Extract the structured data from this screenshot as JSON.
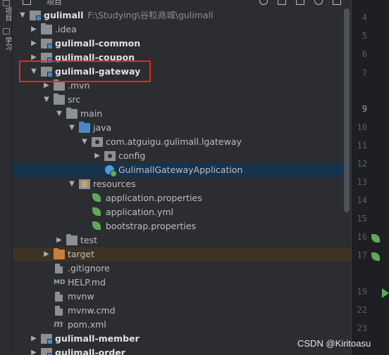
{
  "toolbar": {
    "panel_title": "项目"
  },
  "side_strip": {
    "project_tab": "项目",
    "learn_tab": "学习"
  },
  "editor": {
    "tab_partial": "app"
  },
  "tree": {
    "root": {
      "name": "gulimall",
      "path": "F:\\Studying\\谷粒商城\\gulimall"
    },
    "rows": [
      {
        "label": ".idea",
        "depth": 1,
        "arrow": "right",
        "icon": "folder",
        "bold": false
      },
      {
        "label": "gulimall-common",
        "depth": 1,
        "arrow": "right",
        "icon": "modfolder",
        "bold": true
      },
      {
        "label": "gulimall-coupon",
        "depth": 1,
        "arrow": "right",
        "icon": "modfolder",
        "bold": true
      },
      {
        "label": "gulimall-gateway",
        "depth": 1,
        "arrow": "down",
        "icon": "modfolder",
        "bold": true
      },
      {
        "label": ".mvn",
        "depth": 2,
        "arrow": "right",
        "icon": "folder",
        "bold": false
      },
      {
        "label": "src",
        "depth": 2,
        "arrow": "down",
        "icon": "folder",
        "bold": false
      },
      {
        "label": "main",
        "depth": 3,
        "arrow": "down",
        "icon": "folder",
        "bold": false
      },
      {
        "label": "java",
        "depth": 4,
        "arrow": "down",
        "icon": "folder-blue",
        "bold": false
      },
      {
        "label": "com.atguigu.gulimall.lgateway",
        "depth": 5,
        "arrow": "down",
        "icon": "pkg",
        "bold": false
      },
      {
        "label": "config",
        "depth": 6,
        "arrow": "right",
        "icon": "pkg",
        "bold": false
      },
      {
        "label": "GulimallGatewayApplication",
        "depth": 6,
        "arrow": "none",
        "icon": "class",
        "bold": false,
        "selected": true
      },
      {
        "label": "resources",
        "depth": 4,
        "arrow": "down",
        "icon": "resfolder",
        "bold": false
      },
      {
        "label": "application.properties",
        "depth": 5,
        "arrow": "none",
        "icon": "spring",
        "bold": false
      },
      {
        "label": "application.yml",
        "depth": 5,
        "arrow": "none",
        "icon": "spring",
        "bold": false
      },
      {
        "label": "bootstrap.properties",
        "depth": 5,
        "arrow": "none",
        "icon": "spring",
        "bold": false
      },
      {
        "label": "test",
        "depth": 3,
        "arrow": "right",
        "icon": "folder",
        "bold": false
      },
      {
        "label": "target",
        "depth": 2,
        "arrow": "right",
        "icon": "folder-orange",
        "bold": false,
        "target": true
      },
      {
        "label": ".gitignore",
        "depth": 2,
        "arrow": "none",
        "icon": "file",
        "bold": false
      },
      {
        "label": "HELP.md",
        "depth": 2,
        "arrow": "none",
        "icon": "md",
        "bold": false
      },
      {
        "label": "mvnw",
        "depth": 2,
        "arrow": "none",
        "icon": "file",
        "bold": false
      },
      {
        "label": "mvnw.cmd",
        "depth": 2,
        "arrow": "none",
        "icon": "file",
        "bold": false
      },
      {
        "label": "pom.xml",
        "depth": 2,
        "arrow": "none",
        "icon": "mvn",
        "bold": false
      },
      {
        "label": "gulimall-member",
        "depth": 1,
        "arrow": "right",
        "icon": "modfolder",
        "bold": true
      },
      {
        "label": "gulimall-order",
        "depth": 1,
        "arrow": "right",
        "icon": "modfolder",
        "bold": true
      }
    ]
  },
  "gutter": {
    "lines": [
      "4",
      "5",
      "6",
      "7",
      "9",
      "10",
      "11",
      "12",
      "13",
      "14",
      "15",
      "16",
      "17",
      "19",
      "22",
      "23"
    ],
    "current_line": "9"
  },
  "watermark": "CSDN @Kiritoasu",
  "colors": {
    "highlight_box": "#e8252a",
    "selection": "#17324d",
    "spring_green": "#5fa85a"
  }
}
